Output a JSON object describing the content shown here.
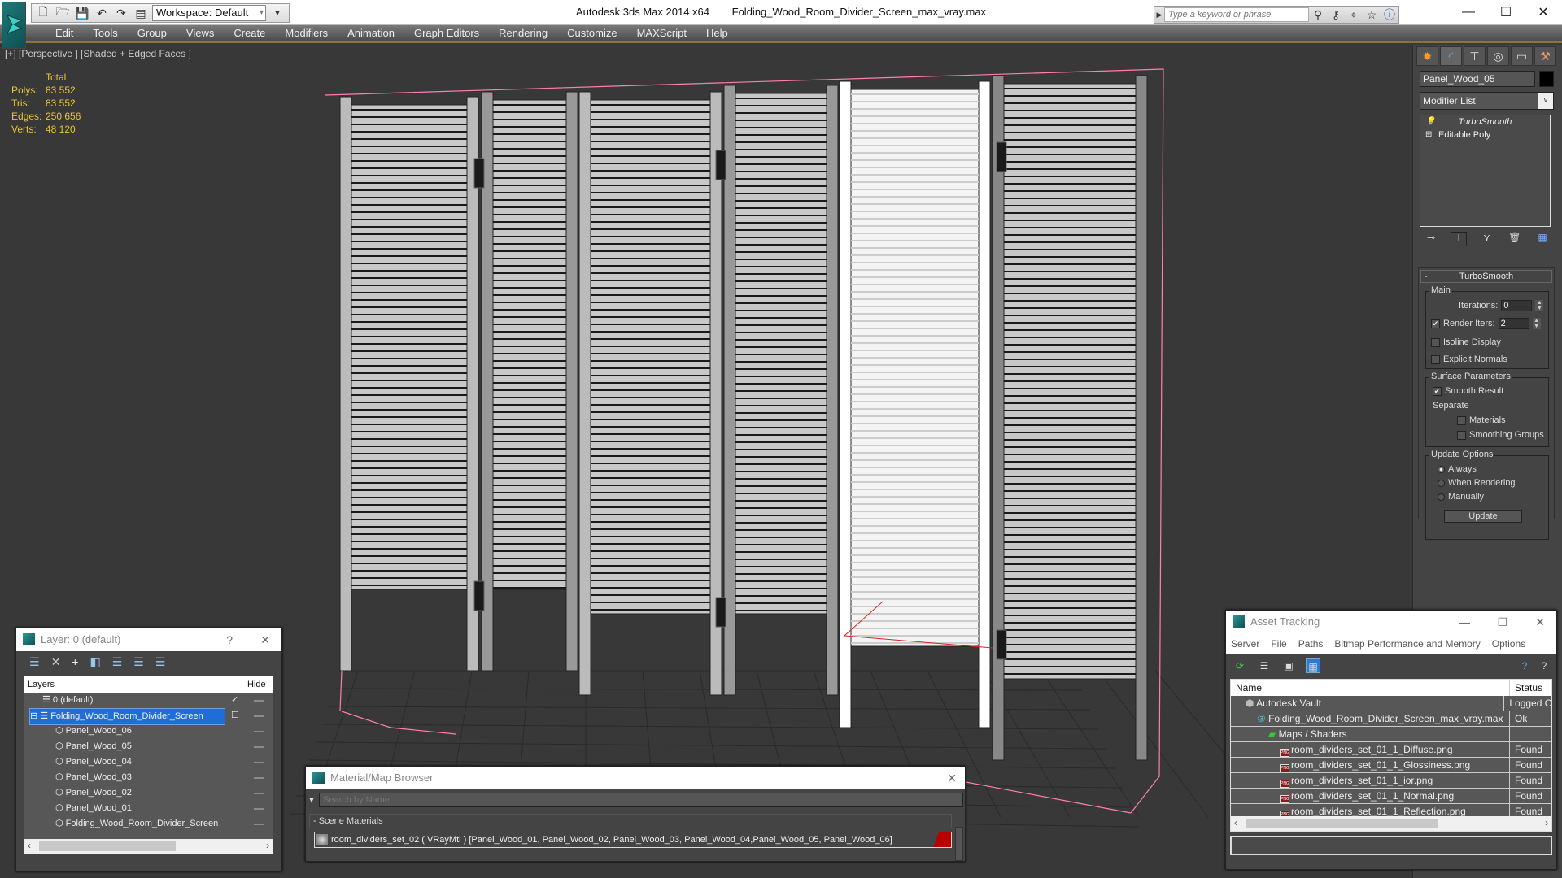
{
  "titlebar": {
    "app_name": "Autodesk 3ds Max  2014 x64",
    "file_name": "Folding_Wood_Room_Divider_Screen_max_vray.max",
    "workspace": "Workspace: Default",
    "search_placeholder": "Type a keyword or phrase",
    "quick_access_icons": [
      "new-file-icon",
      "open-folder-icon",
      "save-icon",
      "undo-icon",
      "redo-icon",
      "project-folder-icon"
    ],
    "search_tools": [
      "binoculars-icon",
      "key-icon",
      "satellite-icon",
      "star-icon",
      "help-icon"
    ],
    "window_controls": {
      "minimize": "—",
      "maximize": "☐",
      "close": "✕"
    }
  },
  "menubar": {
    "items": [
      "Edit",
      "Tools",
      "Group",
      "Views",
      "Create",
      "Modifiers",
      "Animation",
      "Graph Editors",
      "Rendering",
      "Customize",
      "MAXScript",
      "Help"
    ]
  },
  "viewport": {
    "label": "[+] [Perspective ] [Shaded + Edged Faces ]",
    "stats": {
      "header": "Total",
      "rows": [
        {
          "key": "Polys:",
          "value": "83 552"
        },
        {
          "key": "Tris:",
          "value": "83 552"
        },
        {
          "key": "Edges:",
          "value": "250 656"
        },
        {
          "key": "Verts:",
          "value": "48 120"
        }
      ]
    },
    "selection_color": "#ff7fb0",
    "stats_color": "#e8c532"
  },
  "command_panel": {
    "tabs": [
      "create-icon",
      "modify-icon",
      "hierarchy-icon",
      "motion-icon",
      "display-icon",
      "utilities-icon"
    ],
    "object_name": "Panel_Wood_05",
    "modifier_list": "Modifier List",
    "stack": [
      {
        "label": "TurboSmooth"
      },
      {
        "label": "Editable Poly"
      }
    ],
    "turbosmooth": {
      "title": "TurboSmooth",
      "main_title": "Main",
      "iterations_label": "Iterations:",
      "iterations": "0",
      "render_iters_label": "Render Iters:",
      "render_iters": "2",
      "render_iters_checked": true,
      "isoline_label": "Isoline Display",
      "explicit_normals_label": "Explicit Normals",
      "surface_title": "Surface Parameters",
      "smooth_result_label": "Smooth Result",
      "separate_label": "Separate",
      "materials_label": "Materials",
      "smoothing_groups_label": "Smoothing Groups",
      "update_title": "Update Options",
      "update_options": [
        "Always",
        "When Rendering",
        "Manually"
      ],
      "update_selected": "Always",
      "update_button": "Update"
    }
  },
  "layer_dialog": {
    "title": "Layer: 0 (default)",
    "help": "?",
    "close": "✕",
    "col_layers": "Layers",
    "col_hide": "Hide",
    "rows": [
      {
        "name": "0 (default)",
        "level": 1,
        "type": "layer",
        "check": "✓"
      },
      {
        "name": "Folding_Wood_Room_Divider_Screen",
        "level": 0,
        "type": "layer",
        "selected": true,
        "check": "☐",
        "expander": "⊟"
      },
      {
        "name": "Panel_Wood_06",
        "level": 2,
        "type": "object"
      },
      {
        "name": "Panel_Wood_05",
        "level": 2,
        "type": "object"
      },
      {
        "name": "Panel_Wood_04",
        "level": 2,
        "type": "object"
      },
      {
        "name": "Panel_Wood_03",
        "level": 2,
        "type": "object"
      },
      {
        "name": "Panel_Wood_02",
        "level": 2,
        "type": "object"
      },
      {
        "name": "Panel_Wood_01",
        "level": 2,
        "type": "object"
      },
      {
        "name": "Folding_Wood_Room_Divider_Screen",
        "level": 2,
        "type": "object"
      }
    ]
  },
  "material_browser": {
    "title": "Material/Map Browser",
    "close": "✕",
    "search_placeholder": "Search by Name ...",
    "group": "- Scene Materials",
    "item": "room_dividers_set_02  ( VRayMtl ) [Panel_Wood_01, Panel_Wood_02, Panel_Wood_03, Panel_Wood_04,Panel_Wood_05, Panel_Wood_06]"
  },
  "asset_tracking": {
    "title": "Asset Tracking",
    "menu": [
      "Server",
      "File",
      "Paths",
      "Bitmap Performance and Memory",
      "Options"
    ],
    "col_name": "Name",
    "col_status": "Status",
    "rows": [
      {
        "name": "Autodesk Vault",
        "status": "Logged O",
        "indent": 1,
        "icon": "vault-icon"
      },
      {
        "name": "Folding_Wood_Room_Divider_Screen_max_vray.max",
        "status": "Ok",
        "indent": 2,
        "icon": "max-file-icon"
      },
      {
        "name": "Maps / Shaders",
        "status": "",
        "indent": 3,
        "icon": "maps-icon"
      },
      {
        "name": "room_dividers_set_01_1_Diffuse.png",
        "status": "Found",
        "indent": 4,
        "icon": "png-icon"
      },
      {
        "name": "room_dividers_set_01_1_Glossiness.png",
        "status": "Found",
        "indent": 4,
        "icon": "png-icon"
      },
      {
        "name": "room_dividers_set_01_1_ior.png",
        "status": "Found",
        "indent": 4,
        "icon": "png-icon"
      },
      {
        "name": "room_dividers_set_01_1_Normal.png",
        "status": "Found",
        "indent": 4,
        "icon": "png-icon"
      },
      {
        "name": "room_dividers_set_01_1_Reflection.png",
        "status": "Found",
        "indent": 4,
        "icon": "png-icon"
      }
    ]
  }
}
